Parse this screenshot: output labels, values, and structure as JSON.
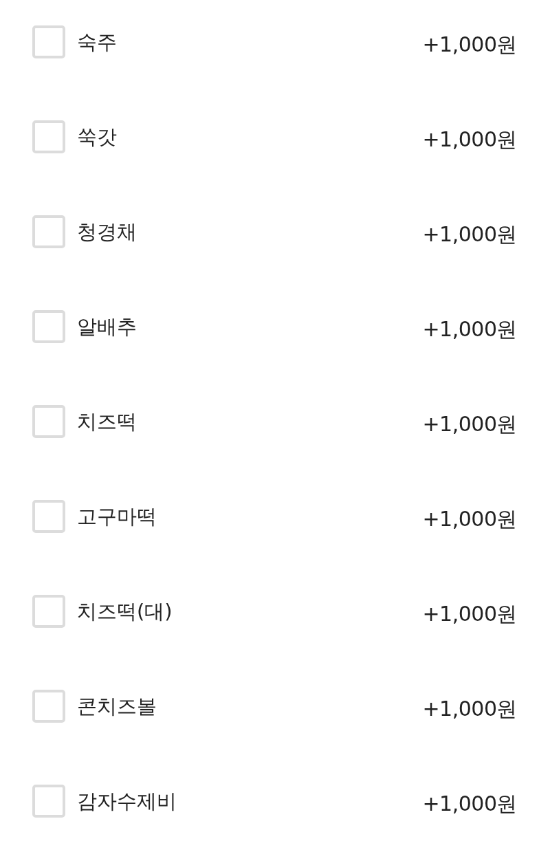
{
  "options": [
    {
      "label": "숙주",
      "price": "+1,000원",
      "checked": false
    },
    {
      "label": "쑥갓",
      "price": "+1,000원",
      "checked": false
    },
    {
      "label": "청경채",
      "price": "+1,000원",
      "checked": false
    },
    {
      "label": "알배추",
      "price": "+1,000원",
      "checked": false
    },
    {
      "label": "치즈떡",
      "price": "+1,000원",
      "checked": false
    },
    {
      "label": "고구마떡",
      "price": "+1,000원",
      "checked": false
    },
    {
      "label": "치즈떡(대)",
      "price": "+1,000원",
      "checked": false
    },
    {
      "label": "콘치즈볼",
      "price": "+1,000원",
      "checked": false
    },
    {
      "label": "감자수제비",
      "price": "+1,000원",
      "checked": false
    }
  ]
}
